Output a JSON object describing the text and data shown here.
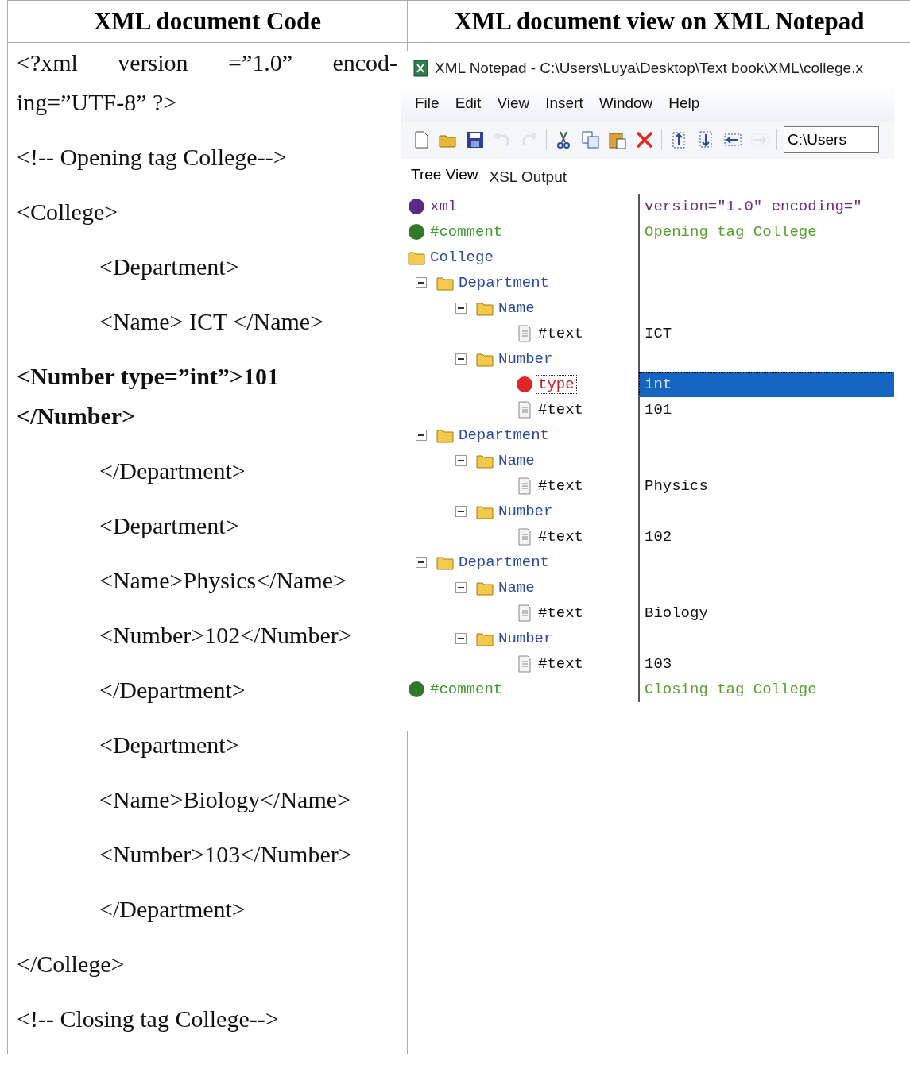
{
  "table": {
    "columns": [
      "XML document Code",
      "XML document view on XML Notepad"
    ]
  },
  "code_lines": [
    {
      "kind": "plain",
      "text": "<?xml version =”1.0” encod-ing=”UTF-8” ?>"
    },
    {
      "kind": "plain",
      "text": "<!-- Opening tag College-->"
    },
    {
      "kind": "plain",
      "text": "<College>"
    },
    {
      "kind": "nested",
      "text": "<Department>"
    },
    {
      "kind": "nested",
      "text": "<Name> ICT </Name>"
    },
    {
      "kind": "bold",
      "text": "<Number type=”int”>101    </Number>"
    },
    {
      "kind": "nested",
      "text": "</Department>"
    },
    {
      "kind": "nested",
      "text": "<Department>"
    },
    {
      "kind": "nested",
      "text": "<Name>Physics</Name>"
    },
    {
      "kind": "nested",
      "text": "<Number>102</Number>"
    },
    {
      "kind": "nested",
      "text": "</Department>"
    },
    {
      "kind": "nested",
      "text": "<Department>"
    },
    {
      "kind": "nested",
      "text": "<Name>Biology</Name>"
    },
    {
      "kind": "nested",
      "text": "<Number>103</Number>"
    },
    {
      "kind": "nested",
      "text": "</Department>"
    },
    {
      "kind": "plain",
      "text": "</College>"
    },
    {
      "kind": "plain",
      "text": "<!-- Closing tag College-->"
    }
  ],
  "window": {
    "title": "XML Notepad - C:\\Users\\Luya\\Desktop\\Text book\\XML\\college.x"
  },
  "menu": [
    "File",
    "Edit",
    "View",
    "Insert",
    "Window",
    "Help"
  ],
  "toolbar": [
    {
      "kind": "new",
      "disabled": false
    },
    {
      "kind": "open",
      "disabled": false
    },
    {
      "kind": "save",
      "disabled": false
    },
    {
      "kind": "undo",
      "disabled": true
    },
    {
      "kind": "redo",
      "disabled": true
    },
    {
      "kind": "cut",
      "disabled": false
    },
    {
      "kind": "copy",
      "disabled": false
    },
    {
      "kind": "paste",
      "disabled": false
    },
    {
      "kind": "delete",
      "disabled": false
    },
    {
      "kind": "up",
      "disabled": false
    },
    {
      "kind": "down",
      "disabled": false
    },
    {
      "kind": "left",
      "disabled": false
    },
    {
      "kind": "right",
      "disabled": true
    }
  ],
  "location": {
    "value": "C:\\Users"
  },
  "tabs": [
    {
      "label": "Tree View",
      "selected": true
    },
    {
      "label": "XSL Output",
      "selected": false
    }
  ],
  "tree": [
    {
      "kind": "pi",
      "name": "xml",
      "value": "version=\"1.0\" encoding=\"",
      "selected": false
    },
    {
      "kind": "comment",
      "name": "#comment",
      "value": "Opening tag College",
      "selected": false
    },
    {
      "kind": "element",
      "name": "College",
      "selected": false,
      "children": [
        {
          "kind": "element",
          "name": "Department",
          "selected": false,
          "children": [
            {
              "kind": "element",
              "name": "Name",
              "selected": false,
              "children": [
                {
                  "kind": "text",
                  "name": "#text",
                  "value": "ICT",
                  "selected": false
                }
              ]
            },
            {
              "kind": "element",
              "name": "Number",
              "selected": false,
              "children": [
                {
                  "kind": "attribute",
                  "name": "type",
                  "value": "int",
                  "selected": true
                },
                {
                  "kind": "text",
                  "name": "#text",
                  "value": "101",
                  "selected": false
                }
              ]
            }
          ]
        },
        {
          "kind": "element",
          "name": "Department",
          "selected": false,
          "children": [
            {
              "kind": "element",
              "name": "Name",
              "selected": false,
              "children": [
                {
                  "kind": "text",
                  "name": "#text",
                  "value": "Physics",
                  "selected": false
                }
              ]
            },
            {
              "kind": "element",
              "name": "Number",
              "selected": false,
              "children": [
                {
                  "kind": "text",
                  "name": "#text",
                  "value": "102",
                  "selected": false
                }
              ]
            }
          ]
        },
        {
          "kind": "element",
          "name": "Department",
          "selected": false,
          "children": [
            {
              "kind": "element",
              "name": "Name",
              "selected": false,
              "children": [
                {
                  "kind": "text",
                  "name": "#text",
                  "value": "Biology",
                  "selected": false
                }
              ]
            },
            {
              "kind": "element",
              "name": "Number",
              "selected": false,
              "children": [
                {
                  "kind": "text",
                  "name": "#text",
                  "value": "103",
                  "selected": false
                }
              ]
            }
          ]
        }
      ]
    },
    {
      "kind": "comment",
      "name": "#comment",
      "value": "Closing tag College",
      "selected": false
    }
  ]
}
